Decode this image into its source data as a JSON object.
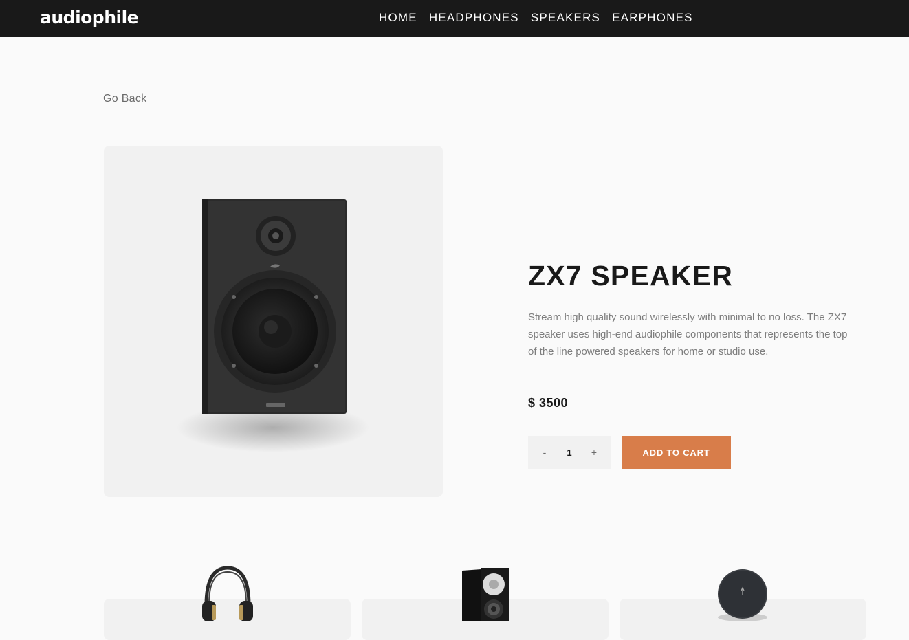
{
  "header": {
    "logo": "audiophile",
    "nav": [
      "HOME",
      "HEADPHONES",
      "SPEAKERS",
      "EARPHONES"
    ]
  },
  "go_back": "Go Back",
  "product": {
    "title": "ZX7 SPEAKER",
    "description": "Stream high quality sound wirelessly with minimal to no loss. The ZX7 speaker uses high-end audiophile components that represents the top of the line powered speakers for home or studio use.",
    "price": "$ 3500",
    "quantity": "1",
    "decrement_label": "-",
    "increment_label": "+",
    "add_to_cart": "ADD TO CART"
  },
  "related": [
    {
      "icon": "headphones"
    },
    {
      "icon": "speaker"
    },
    {
      "icon": "round-speaker"
    }
  ],
  "colors": {
    "accent": "#d87d4a",
    "dark": "#191919",
    "light_gray": "#f1f1f1",
    "background": "#fafafa"
  }
}
